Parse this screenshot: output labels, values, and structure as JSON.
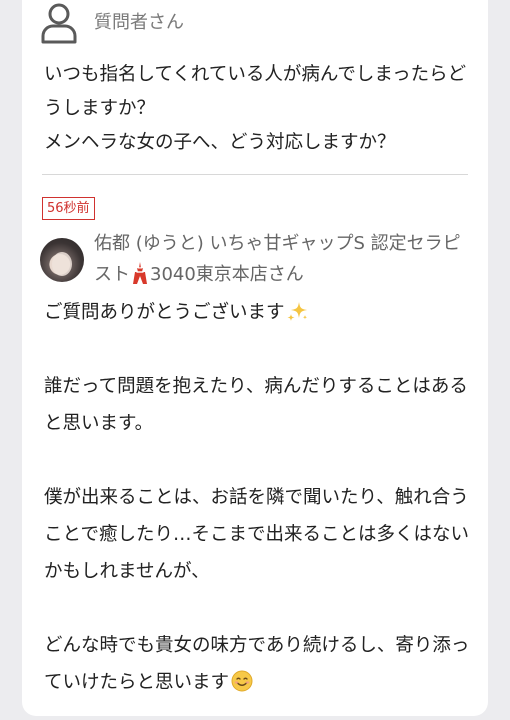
{
  "asker": {
    "icon": "user-outline-icon",
    "name": "質問者さん"
  },
  "question": {
    "text": "いつも指名してくれている人が病んでしまったらどうしますか？\nメンヘラな女の子へ、どう対応しますか？"
  },
  "answer": {
    "time_label": "56秒前",
    "answerer_name_part1": "佑都 (ゆうと) いちゃ甘ギャップS 認定セラピスト",
    "tower_icon": "tokyo-tower-icon",
    "answerer_name_part2": "3040東京本店さん",
    "avatar_icon": "therapist-avatar",
    "paragraphs": [
      "ご質問ありがとうございます",
      "誰だって問題を抱えたり、病んだりすることはあると思います。",
      "僕が出来ることは、お話を隣で聞いたり、触れ合うことで癒したり…そこまで出来ることは多くはないかもしれませんが、",
      "どんな時でも貴女の味方であり続けるし、寄り添っていけたらと思います"
    ],
    "sparkle_icon": "sparkles-icon",
    "smile_icon": "smiling-face-icon"
  },
  "colors": {
    "badge_red": "#d0322f",
    "text": "#222222",
    "muted": "#7a7a7a"
  }
}
